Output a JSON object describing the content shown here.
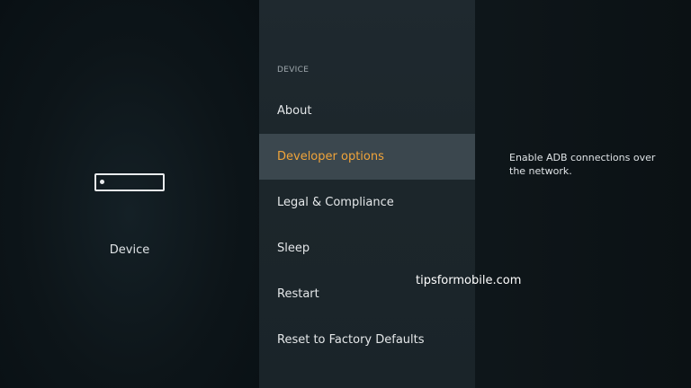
{
  "left_panel": {
    "icon": "device-icon",
    "label": "Device"
  },
  "menu": {
    "section_title": "DEVICE",
    "items": [
      {
        "label": "About",
        "selected": false
      },
      {
        "label": "Developer options",
        "selected": true
      },
      {
        "label": "Legal & Compliance",
        "selected": false
      },
      {
        "label": "Sleep",
        "selected": false
      },
      {
        "label": "Restart",
        "selected": false
      },
      {
        "label": "Reset to Factory Defaults",
        "selected": false
      }
    ]
  },
  "description": "Enable ADB connections over the network.",
  "watermark": "tipsformobile.com",
  "colors": {
    "accent": "#f0a43a",
    "selected_bg": "#3b474e",
    "menu_bg": "#1f292f",
    "background": "#0f1418"
  }
}
